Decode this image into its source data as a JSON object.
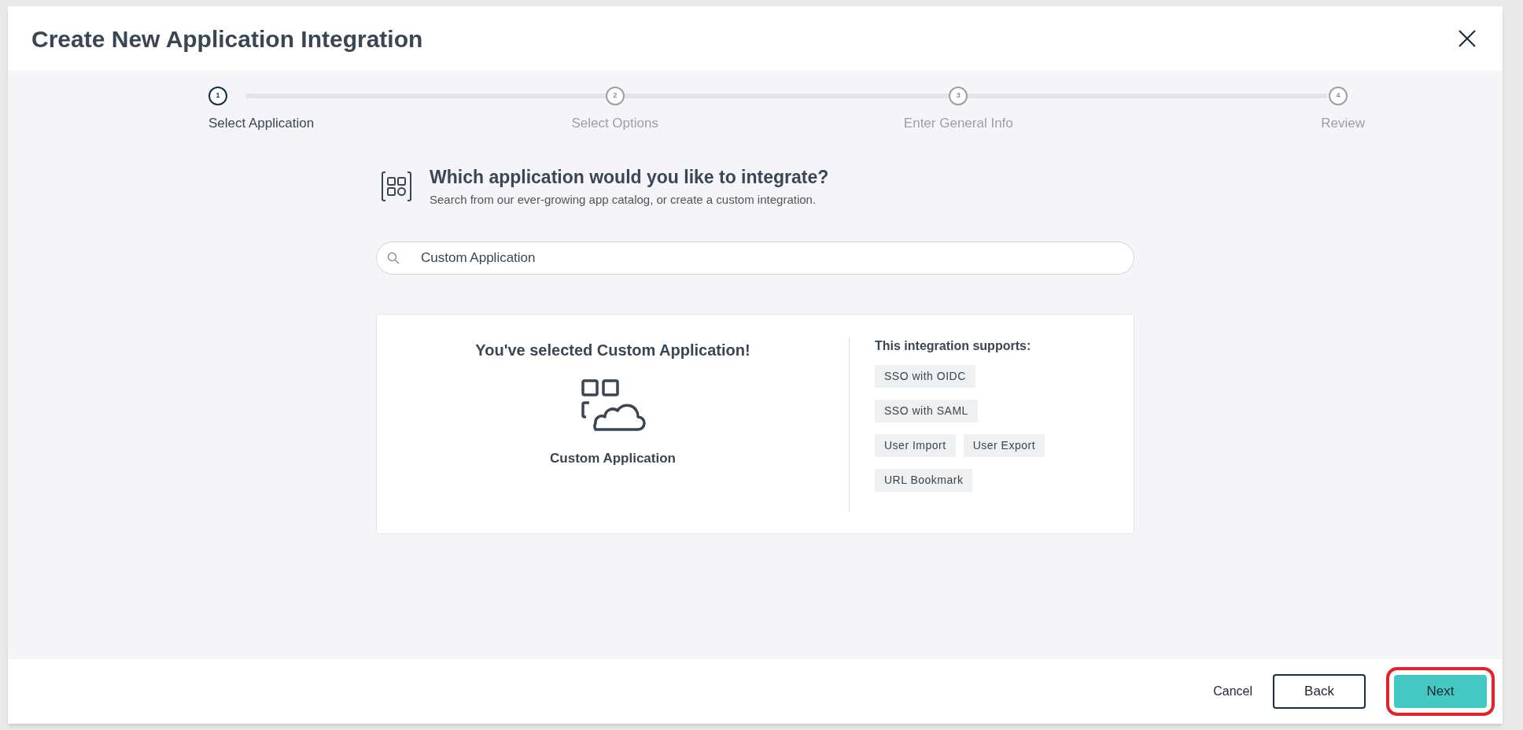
{
  "window": {
    "title": "Create New Application Integration"
  },
  "steps": [
    {
      "number": "1",
      "label": "Select Application",
      "current": true
    },
    {
      "number": "2",
      "label": "Select Options",
      "current": false
    },
    {
      "number": "3",
      "label": "Enter General Info",
      "current": false
    },
    {
      "number": "4",
      "label": "Review",
      "current": false
    }
  ],
  "heading": {
    "title": "Which application would you like to integrate?",
    "subtitle": "Search from our ever-growing app catalog, or create a custom integration."
  },
  "search": {
    "value": "Custom Application"
  },
  "selection": {
    "title": "You've selected Custom Application!",
    "app_name": "Custom Application",
    "supports_title": "This integration supports:",
    "features": [
      "SSO with OIDC",
      "SSO with SAML",
      "User Import",
      "User Export",
      "URL Bookmark"
    ]
  },
  "footer": {
    "cancel": "Cancel",
    "back": "Back",
    "next": "Next",
    "next_highlighted": true
  }
}
